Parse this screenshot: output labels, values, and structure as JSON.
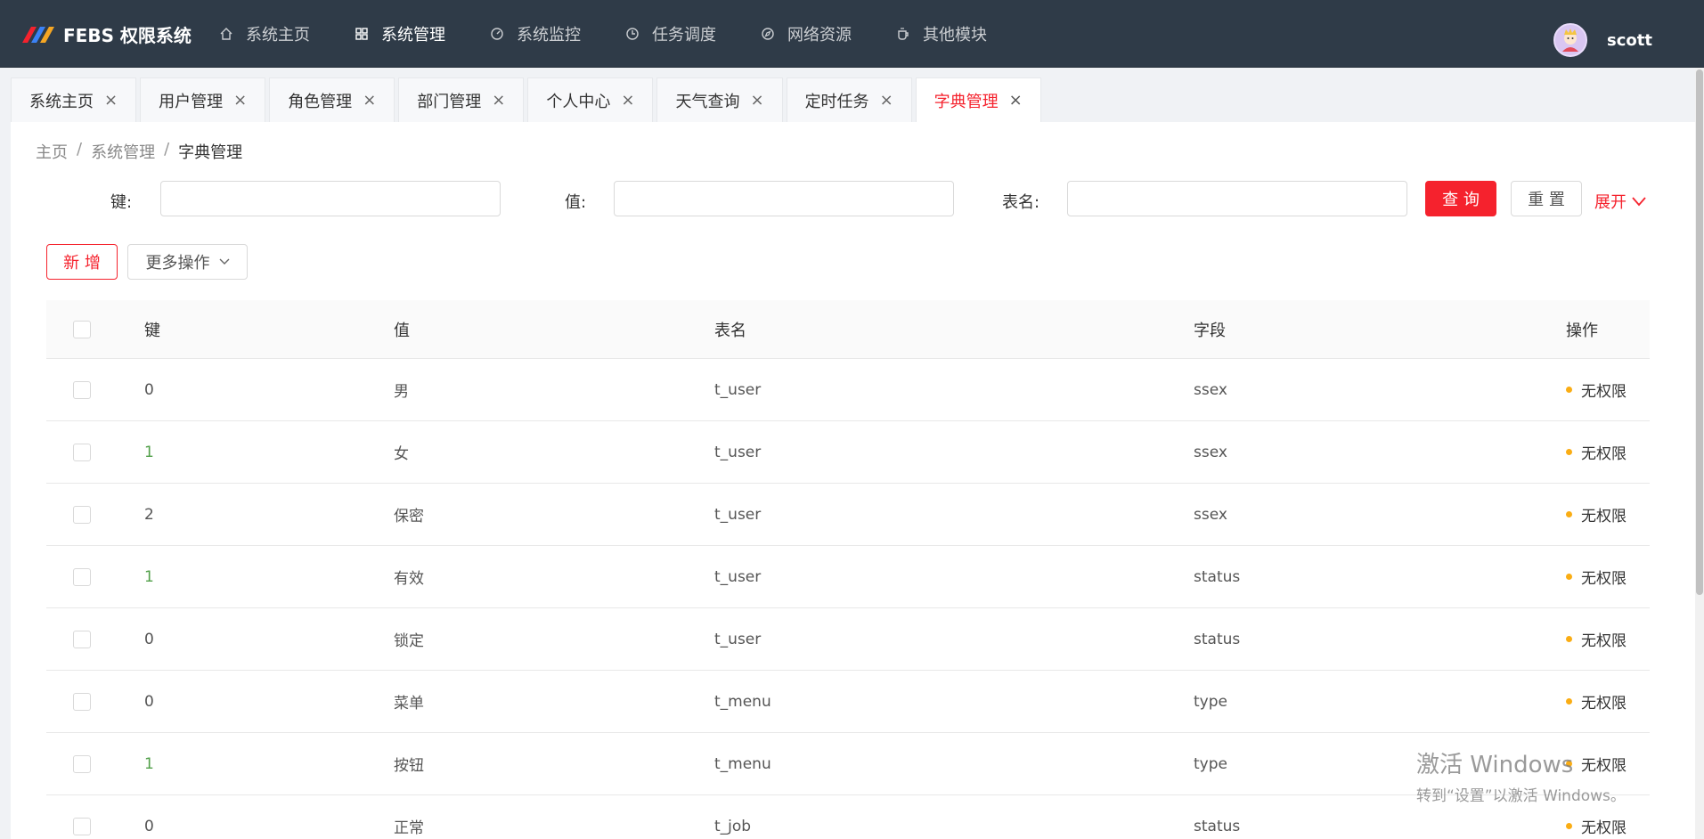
{
  "brand": {
    "title": "FEBS 权限系统"
  },
  "nav": {
    "items": [
      {
        "label": "系统主页",
        "icon": "home-icon"
      },
      {
        "label": "系统管理",
        "icon": "grid-icon"
      },
      {
        "label": "系统监控",
        "icon": "dashboard-icon"
      },
      {
        "label": "任务调度",
        "icon": "clock-icon"
      },
      {
        "label": "网络资源",
        "icon": "compass-icon"
      },
      {
        "label": "其他模块",
        "icon": "coffee-icon"
      }
    ],
    "active_index": 1
  },
  "user": {
    "name": "scott"
  },
  "tabs": [
    {
      "label": "系统主页"
    },
    {
      "label": "用户管理"
    },
    {
      "label": "角色管理"
    },
    {
      "label": "部门管理"
    },
    {
      "label": "个人中心"
    },
    {
      "label": "天气查询"
    },
    {
      "label": "定时任务"
    },
    {
      "label": "字典管理"
    }
  ],
  "tab_close": "×",
  "breadcrumb": {
    "home": "主页",
    "parent": "系统管理",
    "current": "字典管理",
    "sep": "/"
  },
  "search": {
    "key_label": "键:",
    "key_value": "",
    "value_label": "值:",
    "value_value": "",
    "table_label": "表名:",
    "table_value": "",
    "query_label": "查 询",
    "reset_label": "重 置",
    "expand_label": "展开"
  },
  "toolbar": {
    "add_label": "新 增",
    "more_label": "更多操作"
  },
  "table": {
    "columns": {
      "key": "键",
      "value": "值",
      "table": "表名",
      "field": "字段",
      "op": "操作"
    },
    "rows": [
      {
        "key": "0",
        "value": "男",
        "table": "t_user",
        "field": "ssex",
        "op": "无权限"
      },
      {
        "key": "1",
        "value": "女",
        "table": "t_user",
        "field": "ssex",
        "op": "无权限"
      },
      {
        "key": "2",
        "value": "保密",
        "table": "t_user",
        "field": "ssex",
        "op": "无权限"
      },
      {
        "key": "1",
        "value": "有效",
        "table": "t_user",
        "field": "status",
        "op": "无权限"
      },
      {
        "key": "0",
        "value": "锁定",
        "table": "t_user",
        "field": "status",
        "op": "无权限"
      },
      {
        "key": "0",
        "value": "菜单",
        "table": "t_menu",
        "field": "type",
        "op": "无权限"
      },
      {
        "key": "1",
        "value": "按钮",
        "table": "t_menu",
        "field": "type",
        "op": "无权限"
      },
      {
        "key": "0",
        "value": "正常",
        "table": "t_job",
        "field": "status",
        "op": "无权限"
      }
    ]
  },
  "watermark": {
    "line1": "激活 Windows",
    "line2": "转到“设置”以激活 Windows。"
  },
  "colors": {
    "primary": "#f5222d",
    "topbar": "#2f3b48",
    "status_dot": "#faad14"
  }
}
